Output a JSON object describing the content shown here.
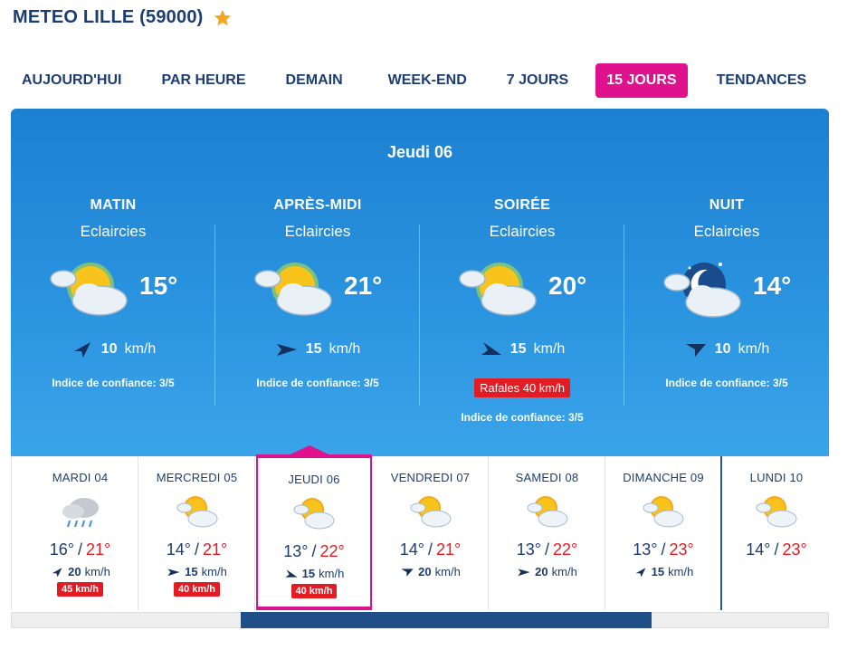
{
  "header": {
    "title": "METEO LILLE (59000)",
    "favorite_icon": "star-icon"
  },
  "tabs": [
    {
      "label": "AUJOURD'HUI",
      "active": false
    },
    {
      "label": "PAR HEURE",
      "active": false
    },
    {
      "label": "DEMAIN",
      "active": false
    },
    {
      "label": "WEEK-END",
      "active": false
    },
    {
      "label": "7 JOURS",
      "active": false
    },
    {
      "label": "15 JOURS",
      "active": true
    },
    {
      "label": "TENDANCES",
      "active": false
    }
  ],
  "detail": {
    "day": "Jeudi 06",
    "periods": [
      {
        "name": "MATIN",
        "condition": "Eclaircies",
        "temp": "15°",
        "icon": "partly-sunny-icon",
        "wind_speed": "10",
        "wind_unit": "km/h",
        "confidence": "Indice de confiance: 3/5",
        "gust": ""
      },
      {
        "name": "APRÈS-MIDI",
        "condition": "Eclaircies",
        "temp": "21°",
        "icon": "partly-sunny-icon",
        "wind_speed": "15",
        "wind_unit": "km/h",
        "confidence": "Indice de confiance: 3/5",
        "gust": ""
      },
      {
        "name": "SOIRÉE",
        "condition": "Eclaircies",
        "temp": "20°",
        "icon": "partly-sunny-icon",
        "wind_speed": "15",
        "wind_unit": "km/h",
        "confidence": "Indice de confiance: 3/5",
        "gust": "Rafales 40 km/h"
      },
      {
        "name": "NUIT",
        "condition": "Eclaircies",
        "temp": "14°",
        "icon": "night-partly-cloudy-icon",
        "wind_speed": "10",
        "wind_unit": "km/h",
        "confidence": "Indice de confiance: 3/5",
        "gust": ""
      }
    ]
  },
  "days": [
    {
      "name": "MARDI 04",
      "icon": "rain-cloud-icon",
      "low": "16°",
      "high": "21°",
      "sep": "/",
      "wind_speed": "20",
      "wind_unit": "km/h",
      "gust": "45 km/h"
    },
    {
      "name": "MERCREDI 05",
      "icon": "partly-sunny-icon",
      "low": "14°",
      "high": "21°",
      "sep": "/",
      "wind_speed": "15",
      "wind_unit": "km/h",
      "gust": "40 km/h"
    },
    {
      "name": "JEUDI 06",
      "icon": "partly-sunny-icon",
      "low": "13°",
      "high": "22°",
      "sep": "/",
      "wind_speed": "15",
      "wind_unit": "km/h",
      "gust": "40 km/h"
    },
    {
      "name": "VENDREDI 07",
      "icon": "partly-sunny-icon",
      "low": "14°",
      "high": "21°",
      "sep": "/",
      "wind_speed": "20",
      "wind_unit": "km/h",
      "gust": ""
    },
    {
      "name": "SAMEDI 08",
      "icon": "partly-sunny-icon",
      "low": "13°",
      "high": "22°",
      "sep": "/",
      "wind_speed": "20",
      "wind_unit": "km/h",
      "gust": ""
    },
    {
      "name": "DIMANCHE 09",
      "icon": "partly-sunny-icon",
      "low": "13°",
      "high": "23°",
      "sep": "/",
      "wind_speed": "15",
      "wind_unit": "km/h",
      "gust": ""
    },
    {
      "name": "LUNDI 10",
      "icon": "partly-sunny-icon",
      "low": "14°",
      "high": "23°",
      "sep": "/",
      "wind_speed": "",
      "wind_unit": "",
      "gust": ""
    }
  ],
  "colors": {
    "accent": "#e0118c",
    "panel": "#2a8fdc",
    "heading": "#1c3d73",
    "warm": "#e31b23"
  }
}
